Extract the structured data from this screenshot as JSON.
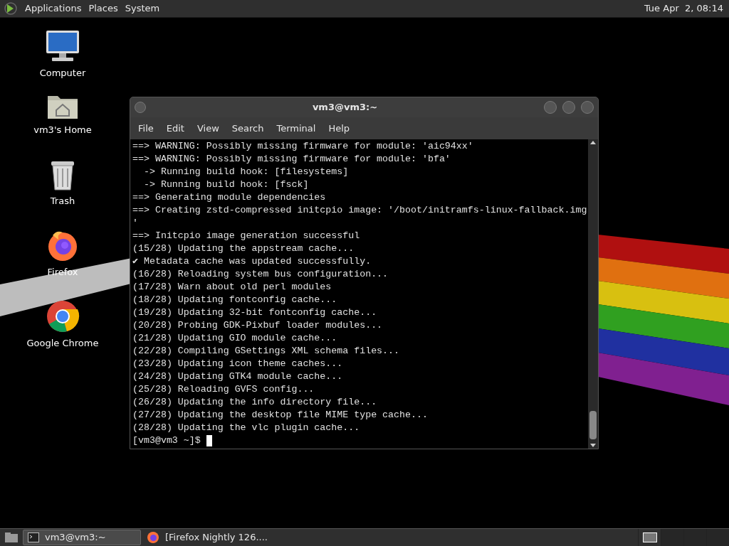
{
  "top_panel": {
    "menus": [
      "Applications",
      "Places",
      "System"
    ],
    "clock": "Tue Apr  2, 08:14"
  },
  "desktop_icons": [
    {
      "kind": "computer",
      "label": "Computer"
    },
    {
      "kind": "home",
      "label": "vm3's Home"
    },
    {
      "kind": "trash",
      "label": "Trash"
    },
    {
      "kind": "firefox",
      "label": "Firefox"
    },
    {
      "kind": "chrome",
      "label": "Google Chrome"
    }
  ],
  "terminal": {
    "title": "vm3@vm3:~",
    "menus": [
      "File",
      "Edit",
      "View",
      "Search",
      "Terminal",
      "Help"
    ],
    "lines": [
      "==> WARNING: Possibly missing firmware for module: 'aic94xx'",
      "==> WARNING: Possibly missing firmware for module: 'bfa'",
      "  -> Running build hook: [filesystems]",
      "  -> Running build hook: [fsck]",
      "==> Generating module dependencies",
      "==> Creating zstd-compressed initcpio image: '/boot/initramfs-linux-fallback.img",
      "'",
      "==> Initcpio image generation successful",
      "(15/28) Updating the appstream cache...",
      "✔ Metadata cache was updated successfully.",
      "(16/28) Reloading system bus configuration...",
      "(17/28) Warn about old perl modules",
      "(18/28) Updating fontconfig cache...",
      "(19/28) Updating 32-bit fontconfig cache...",
      "(20/28) Probing GDK-Pixbuf loader modules...",
      "(21/28) Updating GIO module cache...",
      "(22/28) Compiling GSettings XML schema files...",
      "(23/28) Updating icon theme caches...",
      "(24/28) Updating GTK4 module cache...",
      "(25/28) Reloading GVFS config...",
      "(26/28) Updating the info directory file...",
      "(27/28) Updating the desktop file MIME type cache...",
      "(28/28) Updating the vlc plugin cache..."
    ],
    "prompt": "[vm3@vm3 ~]$ "
  },
  "taskbar": {
    "tasks": [
      {
        "kind": "terminal",
        "label": "vm3@vm3:~",
        "selected": true
      },
      {
        "kind": "firefox",
        "label": "[Firefox Nightly 126....",
        "selected": false
      }
    ],
    "workspaces": [
      {
        "selected": true
      },
      {
        "selected": false
      },
      {
        "selected": false
      },
      {
        "selected": false
      }
    ]
  }
}
